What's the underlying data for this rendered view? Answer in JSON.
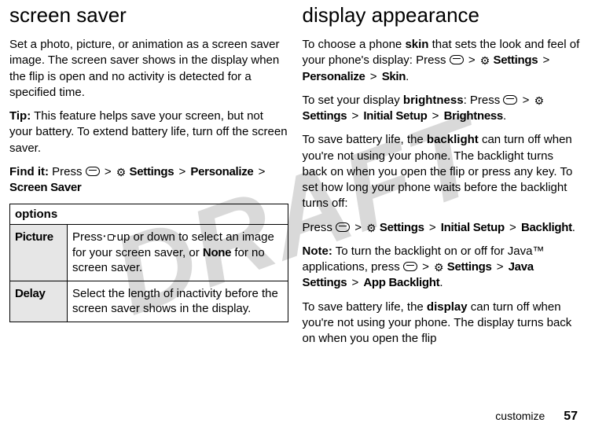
{
  "watermark": "DRAFT",
  "left": {
    "heading": "screen saver",
    "p1": "Set a photo, picture, or animation as a screen saver image. The screen saver shows in the display when the flip is open and no activity is detected for a specified time.",
    "tip_label": "Tip:",
    "tip_body": " This feature helps save your screen, but not your battery. To extend battery life, turn off the screen saver.",
    "findit_label": "Find it:",
    "findit_prefix": " Press ",
    "nav_settings": "Settings",
    "nav_personalize": "Personalize",
    "nav_screensaver": "Screen Saver",
    "table_header": "options",
    "row1_label": "Picture",
    "row1_before": "Press ",
    "row1_mid": " up or down to select an image for your screen saver, or ",
    "row1_none": "None",
    "row1_after": " for no screen saver.",
    "row2_label": "Delay",
    "row2_body": "Select the length of inactivity before the screen saver shows in the display."
  },
  "right": {
    "heading": "display appearance",
    "p1_before": "To choose a phone ",
    "p1_bold": "skin",
    "p1_after": " that sets the look and feel of your phone's display: Press ",
    "nav_settings": "Settings",
    "nav_personalize": "Personalize",
    "nav_skin": "Skin",
    "p2_before": "To set your display ",
    "p2_bold": "brightness",
    "p2_after": ": Press ",
    "nav_initial": "Initial Setup",
    "nav_brightness": "Brightness",
    "p3_before": "To save battery life, the ",
    "p3_bold": "backlight",
    "p3_after": " can turn off when you're not using your phone. The backlight turns back on when you open the flip or press any key. To set how long your phone waits before the backlight turns off:",
    "p4_prefix": "Press ",
    "nav_backlight": "Backlight",
    "note_label": "Note:",
    "note_body1": " To turn the backlight on or off for Java™ applications, press ",
    "nav_java": "Java Settings",
    "nav_appbacklight": "App Backlight",
    "p5_before": "To save battery life, the ",
    "p5_bold": "display",
    "p5_after": " can turn off when you're not using your phone. The display turns back on when you open the flip"
  },
  "sep": ">",
  "gear_glyph": "⚙",
  "footer_label": "customize",
  "footer_page": "57"
}
